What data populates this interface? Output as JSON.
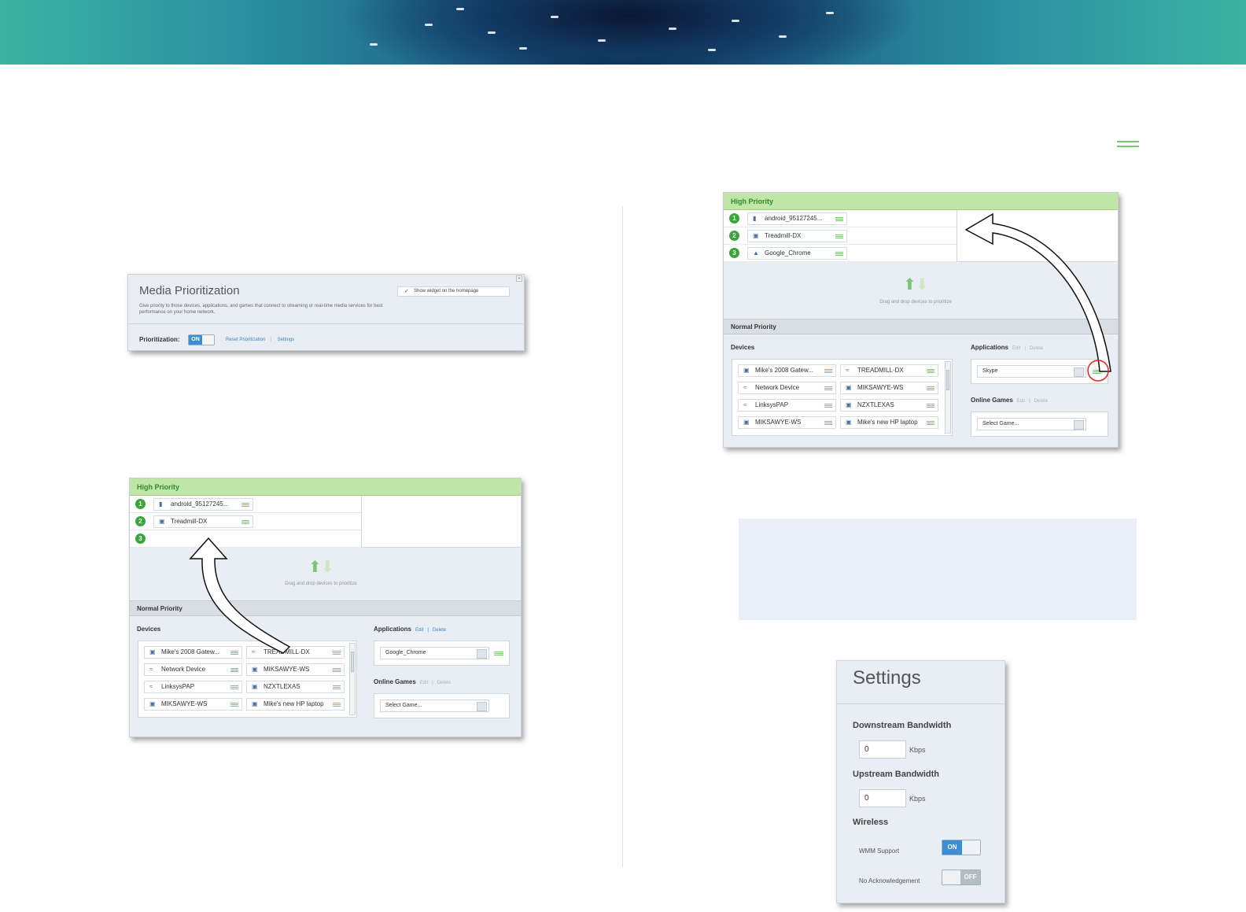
{
  "media_widget": {
    "title": "Media Prioritization",
    "description": "Give priority to those devices, applications, and games that connect to streaming or real-time media services for best performance on your home network.",
    "show_widget_label": "Show widget on the homepage",
    "prioritization_label": "Prioritization:",
    "toggle_state": "ON",
    "reset_link": "Reset Prioritization",
    "settings_link": "Settings"
  },
  "left_panel": {
    "high_priority_title": "High Priority",
    "high_priority_items": [
      {
        "num": "1",
        "label": "android_95127245..."
      },
      {
        "num": "2",
        "label": "Treadmill-DX"
      },
      {
        "num": "3",
        "label": ""
      }
    ],
    "drag_hint": "Drag and drop devices to prioritize",
    "normal_priority_title": "Normal Priority",
    "devices_label": "Devices",
    "devices": [
      "Mike's 2008 Gatew...",
      "TREADMILL-DX",
      "Network Device",
      "MIKSAWYE-WS",
      "LinksysPAP",
      "NZXTLEXAS",
      "MIKSAWYE-WS",
      "Mike's new HP laptop"
    ],
    "applications_label": "Applications",
    "edit_link": "Edit",
    "delete_link": "Delete",
    "applications": [
      "Google_Chrome"
    ],
    "online_games_label": "Online Games",
    "select_game": "Select Game..."
  },
  "right_panel": {
    "high_priority_title": "High Priority",
    "high_priority_items": [
      {
        "num": "1",
        "label": "android_95127245..."
      },
      {
        "num": "2",
        "label": "Treadmill-DX"
      },
      {
        "num": "3",
        "label": "Google_Chrome"
      }
    ],
    "drag_hint": "Drag and drop devices to prioritize",
    "normal_priority_title": "Normal Priority",
    "devices_label": "Devices",
    "devices": [
      "Mike's 2008 Gatew...",
      "TREADMILL-DX",
      "Network Device",
      "MIKSAWYE-WS",
      "LinksysPAP",
      "NZXTLEXAS",
      "MIKSAWYE-WS",
      "Mike's new HP laptop"
    ],
    "applications_label": "Applications",
    "edit_link": "Edit",
    "delete_link": "Delete",
    "applications": [
      "Skype"
    ],
    "online_games_label": "Online Games",
    "select_game": "Select Game..."
  },
  "settings": {
    "title": "Settings",
    "downstream_label": "Downstream Bandwidth",
    "downstream_value": "0",
    "upstream_label": "Upstream Bandwidth",
    "upstream_value": "0",
    "unit": "Kbps",
    "wireless_label": "Wireless",
    "wmm_label": "WMM Support",
    "wmm_state": "ON",
    "noack_label": "No Acknowledgement",
    "noack_state": "OFF"
  },
  "colors": {
    "accent_green": "#7cc576",
    "link_blue": "#3c86c7",
    "toggle_blue": "#3c8ed3",
    "note_bg": "#e9eef7",
    "highlight_red": "#e02020"
  }
}
